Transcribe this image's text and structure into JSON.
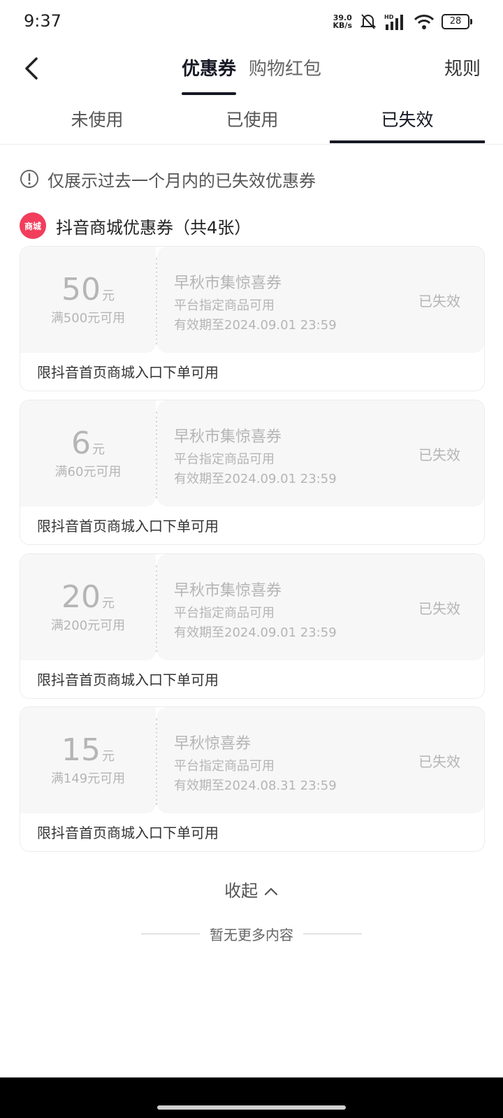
{
  "status_bar": {
    "time": "9:37",
    "net_speed_value": "39.0",
    "net_speed_unit": "KB/s",
    "battery": "28",
    "hd_label": "HD"
  },
  "header": {
    "tabs": [
      {
        "label": "优惠券",
        "active": true
      },
      {
        "label": "购物红包",
        "active": false
      }
    ],
    "rules": "规则"
  },
  "sub_tabs": [
    {
      "label": "未使用",
      "active": false
    },
    {
      "label": "已使用",
      "active": false
    },
    {
      "label": "已失效",
      "active": true
    }
  ],
  "notice": "仅展示过去一个月内的已失效优惠券",
  "section": {
    "logo_text": "商城",
    "title": "抖音商城优惠券（共4张）"
  },
  "coupons": [
    {
      "amount": "50",
      "unit": "元",
      "threshold": "满500元可用",
      "title": "早秋市集惊喜券",
      "scope": "平台指定商品可用",
      "validity": "有效期至2024.09.01 23:59",
      "status": "已失效",
      "note": "限抖音首页商城入口下单可用"
    },
    {
      "amount": "6",
      "unit": "元",
      "threshold": "满60元可用",
      "title": "早秋市集惊喜券",
      "scope": "平台指定商品可用",
      "validity": "有效期至2024.09.01 23:59",
      "status": "已失效",
      "note": "限抖音首页商城入口下单可用"
    },
    {
      "amount": "20",
      "unit": "元",
      "threshold": "满200元可用",
      "title": "早秋市集惊喜券",
      "scope": "平台指定商品可用",
      "validity": "有效期至2024.09.01 23:59",
      "status": "已失效",
      "note": "限抖音首页商城入口下单可用"
    },
    {
      "amount": "15",
      "unit": "元",
      "threshold": "满149元可用",
      "title": "早秋惊喜券",
      "scope": "平台指定商品可用",
      "validity": "有效期至2024.08.31 23:59",
      "status": "已失效",
      "note": "限抖音首页商城入口下单可用"
    }
  ],
  "collapse": "收起",
  "no_more": "暂无更多内容",
  "colors": {
    "accent": "#161823",
    "logo": "#f23d5c",
    "expired_text": "#b5b5b5",
    "card_bg": "#f7f7f7"
  }
}
